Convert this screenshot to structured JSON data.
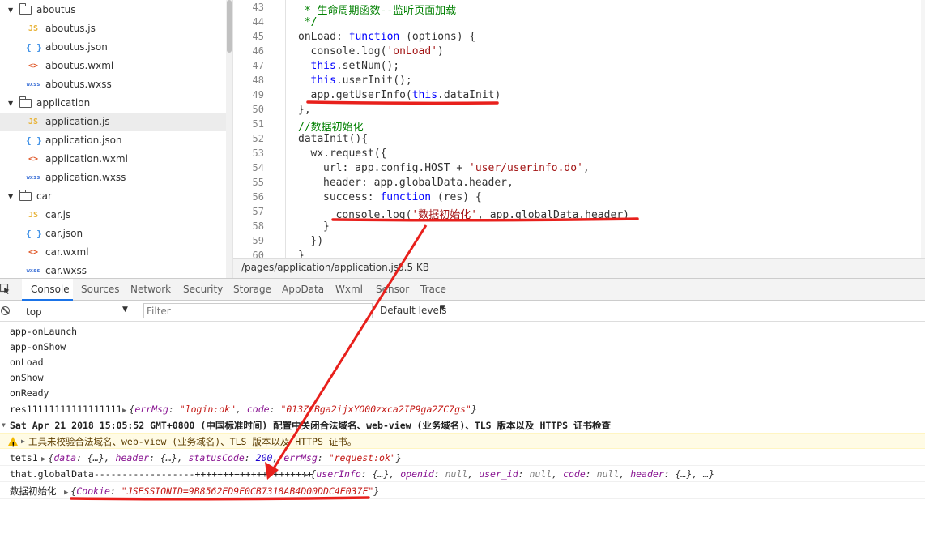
{
  "file_tree": {
    "rows": [
      {
        "kind": "folder",
        "label": "aboutus"
      },
      {
        "kind": "file",
        "type": "js",
        "icon": "JS",
        "label": "aboutus.js"
      },
      {
        "kind": "file",
        "type": "json",
        "icon": "{ }",
        "label": "aboutus.json"
      },
      {
        "kind": "file",
        "type": "wxml",
        "icon": "<>",
        "label": "aboutus.wxml"
      },
      {
        "kind": "file",
        "type": "wxss",
        "icon": "wxss",
        "label": "aboutus.wxss"
      },
      {
        "kind": "folder",
        "label": "application"
      },
      {
        "kind": "file",
        "type": "js",
        "icon": "JS",
        "label": "application.js",
        "selected": true
      },
      {
        "kind": "file",
        "type": "json",
        "icon": "{ }",
        "label": "application.json"
      },
      {
        "kind": "file",
        "type": "wxml",
        "icon": "<>",
        "label": "application.wxml"
      },
      {
        "kind": "file",
        "type": "wxss",
        "icon": "wxss",
        "label": "application.wxss"
      },
      {
        "kind": "folder",
        "label": "car"
      },
      {
        "kind": "file",
        "type": "js",
        "icon": "JS",
        "label": "car.js"
      },
      {
        "kind": "file",
        "type": "json",
        "icon": "{ }",
        "label": "car.json"
      },
      {
        "kind": "file",
        "type": "wxml",
        "icon": "<>",
        "label": "car.wxml"
      },
      {
        "kind": "file",
        "type": "wxss",
        "icon": "wxss",
        "label": "car.wxss"
      }
    ]
  },
  "editor": {
    "lines": [
      {
        "num": "43",
        "indent": 0,
        "parts": [
          {
            "c": "cmt",
            "t": " * 生命周期函数--监听页面加载"
          }
        ]
      },
      {
        "num": "44",
        "indent": 0,
        "parts": [
          {
            "c": "cmt",
            "t": " */"
          }
        ]
      },
      {
        "num": "45",
        "indent": 0,
        "parts": [
          {
            "t": "onLoad: "
          },
          {
            "c": "kw",
            "t": "function"
          },
          {
            "t": " (options) {"
          }
        ]
      },
      {
        "num": "46",
        "indent": 1,
        "parts": [
          {
            "t": "console.log("
          },
          {
            "c": "str",
            "t": "'onLoad'"
          },
          {
            "t": ")"
          }
        ]
      },
      {
        "num": "47",
        "indent": 1,
        "parts": [
          {
            "c": "kw",
            "t": "this"
          },
          {
            "t": ".setNum();"
          }
        ]
      },
      {
        "num": "48",
        "indent": 1,
        "parts": [
          {
            "c": "kw",
            "t": "this"
          },
          {
            "t": ".userInit();"
          }
        ]
      },
      {
        "num": "49",
        "indent": 1,
        "parts": [
          {
            "t": "app.getUserInfo("
          },
          {
            "c": "kw",
            "t": "this"
          },
          {
            "t": ".dataInit)"
          }
        ]
      },
      {
        "num": "50",
        "indent": 0,
        "parts": [
          {
            "t": "},"
          }
        ]
      },
      {
        "num": "51",
        "indent": 0,
        "parts": [
          {
            "c": "cmt",
            "t": "//数据初始化"
          }
        ]
      },
      {
        "num": "52",
        "indent": 0,
        "parts": [
          {
            "t": "dataInit(){"
          }
        ]
      },
      {
        "num": "53",
        "indent": 1,
        "parts": [
          {
            "t": "wx.request({"
          }
        ]
      },
      {
        "num": "54",
        "indent": 2,
        "parts": [
          {
            "t": "url: app.config.HOST + "
          },
          {
            "c": "str",
            "t": "'user/userinfo.do'"
          },
          {
            "t": ","
          }
        ]
      },
      {
        "num": "55",
        "indent": 2,
        "parts": [
          {
            "t": "header: app.globalData.header,"
          }
        ]
      },
      {
        "num": "56",
        "indent": 2,
        "parts": [
          {
            "t": "success: "
          },
          {
            "c": "kw",
            "t": "function"
          },
          {
            "t": " (res) {"
          }
        ]
      },
      {
        "num": "57",
        "indent": 3,
        "parts": [
          {
            "t": "console.log("
          },
          {
            "c": "str",
            "t": "'数据初始化'"
          },
          {
            "t": ", app.globalData.header)"
          }
        ]
      },
      {
        "num": "58",
        "indent": 2,
        "parts": [
          {
            "t": "}"
          }
        ]
      },
      {
        "num": "59",
        "indent": 1,
        "parts": [
          {
            "t": "})"
          }
        ]
      },
      {
        "num": "60",
        "indent": 0,
        "parts": [
          {
            "t": "}"
          }
        ]
      }
    ]
  },
  "status": {
    "path": "/pages/application/application.js",
    "size": "6.5 KB"
  },
  "devtools": {
    "tabs": [
      "Console",
      "Sources",
      "Network",
      "Security",
      "Storage",
      "AppData",
      "Wxml",
      "Sensor",
      "Trace"
    ],
    "active_tab": "Console"
  },
  "console_toolbar": {
    "context": "top",
    "filter_placeholder": "Filter",
    "levels": "Default levels"
  },
  "console": {
    "plain_logs": [
      "app-onLaunch",
      "app-onShow",
      "onLoad",
      "onShow",
      "onReady"
    ],
    "res_label": "res11111111111111111",
    "res_obj": [
      {
        "c": "k",
        "t": "errMsg"
      },
      {
        "t": ": "
      },
      {
        "c": "s",
        "t": "\"login:ok\""
      },
      {
        "t": ", "
      },
      {
        "c": "k",
        "t": "code"
      },
      {
        "t": ": "
      },
      {
        "c": "s",
        "t": "\"013ZCBga2ijxYO00zxca2IP9ga2ZC7gs\""
      },
      {
        "t": "}"
      }
    ],
    "bold_line": "Sat Apr 21 2018 15:05:52 GMT+0800 (中国标准时间) 配置中关闭合法域名、web-view (业务域名)、TLS 版本以及 HTTPS 证书检查",
    "warning_text": "工具未校验合法域名、web-view (业务域名)、TLS 版本以及 HTTPS 证书。",
    "tets_label": "tets1",
    "tets_obj": [
      {
        "c": "k",
        "t": "data"
      },
      {
        "t": ": {…}, "
      },
      {
        "c": "k",
        "t": "header"
      },
      {
        "t": ": {…}, "
      },
      {
        "c": "k",
        "t": "statusCode"
      },
      {
        "t": ": "
      },
      {
        "c": "n",
        "t": "200"
      },
      {
        "t": ", "
      },
      {
        "c": "k",
        "t": "errMsg"
      },
      {
        "t": ": "
      },
      {
        "c": "s",
        "t": "\"request:ok\""
      },
      {
        "t": "}"
      }
    ],
    "global_label": "that.globalData------------------+++++++++++++++++++++",
    "global_obj": [
      {
        "c": "k",
        "t": "userInfo"
      },
      {
        "t": ": {…}, "
      },
      {
        "c": "k",
        "t": "openid"
      },
      {
        "t": ": "
      },
      {
        "c": "nl",
        "t": "null"
      },
      {
        "t": ", "
      },
      {
        "c": "k",
        "t": "user_id"
      },
      {
        "t": ": "
      },
      {
        "c": "nl",
        "t": "null"
      },
      {
        "t": ", "
      },
      {
        "c": "k",
        "t": "code"
      },
      {
        "t": ": "
      },
      {
        "c": "nl",
        "t": "null"
      },
      {
        "t": ", "
      },
      {
        "c": "k",
        "t": "header"
      },
      {
        "t": ": {…}, …}"
      }
    ],
    "init_label": "数据初始化",
    "init_obj": [
      {
        "c": "k",
        "t": "Cookie"
      },
      {
        "t": ": "
      },
      {
        "c": "s",
        "t": "\"JSESSIONID=9B8562ED9F0CB7318AB4D00DDC4E037F\""
      },
      {
        "t": "}"
      }
    ]
  },
  "colors": {
    "annotation": "#e8201c",
    "active_tab_underline": "#1a73e8",
    "js_icon": "#e8b43a",
    "json_icon": "#3a8ee6",
    "wxml_icon": "#e05a2b",
    "wxss_icon": "#3a6fd6"
  },
  "icons": [
    "folder-icon",
    "caret-down-icon",
    "inspect-icon",
    "clear-console-icon",
    "dropdown-arrow-icon",
    "warning-icon",
    "expand-caret-icon"
  ]
}
